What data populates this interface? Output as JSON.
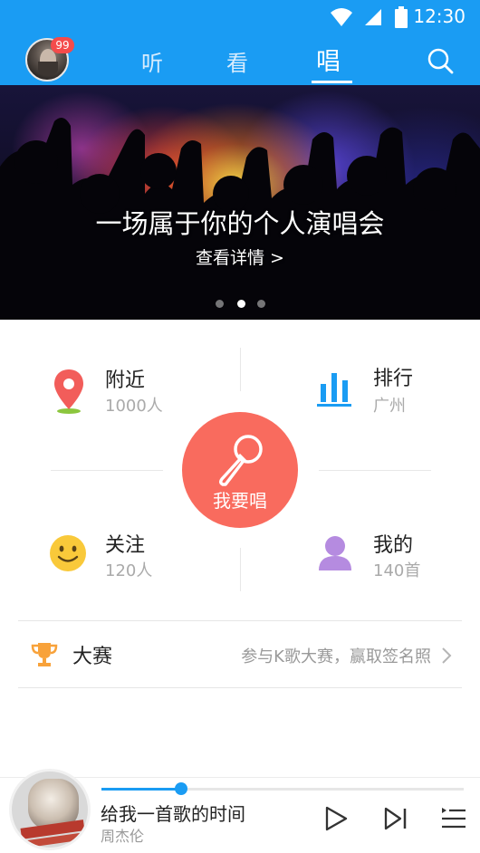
{
  "status_bar": {
    "time": "12:30"
  },
  "nav": {
    "badge": "99",
    "tabs": [
      {
        "label": "听"
      },
      {
        "label": "看"
      },
      {
        "label": "唱",
        "active": true
      }
    ]
  },
  "banner": {
    "title": "一场属于你的个人演唱会",
    "link": "查看详情 >",
    "slide_count": 3,
    "active_slide": 2
  },
  "features": {
    "nearby": {
      "label": "附近",
      "sub": "1000人"
    },
    "ranking": {
      "label": "排行",
      "sub": "广州"
    },
    "follow": {
      "label": "关注",
      "sub": "120人"
    },
    "mine": {
      "label": "我的",
      "sub": "140首"
    },
    "sing_button": "我要唱"
  },
  "contest": {
    "title": "大赛",
    "description": "参与K歌大赛，赢取签名照"
  },
  "player": {
    "song": "给我一首歌的时间",
    "artist": "周杰伦",
    "progress": 0.22
  },
  "colors": {
    "primary": "#1a9cf3",
    "sing": "#f96b5e",
    "nearby": "#f25d5a",
    "ranking": "#1a9cf3",
    "follow": "#f9c93a",
    "mine": "#b58be0",
    "trophy": "#f8a23a"
  },
  "icons": {
    "search": "search-icon",
    "nearby": "location-pin-icon",
    "ranking": "bar-chart-icon",
    "follow": "smiley-icon",
    "mine": "user-icon",
    "sing": "microphone-icon",
    "contest": "trophy-icon",
    "play": "play-icon",
    "next": "next-track-icon",
    "playlist": "playlist-icon"
  }
}
